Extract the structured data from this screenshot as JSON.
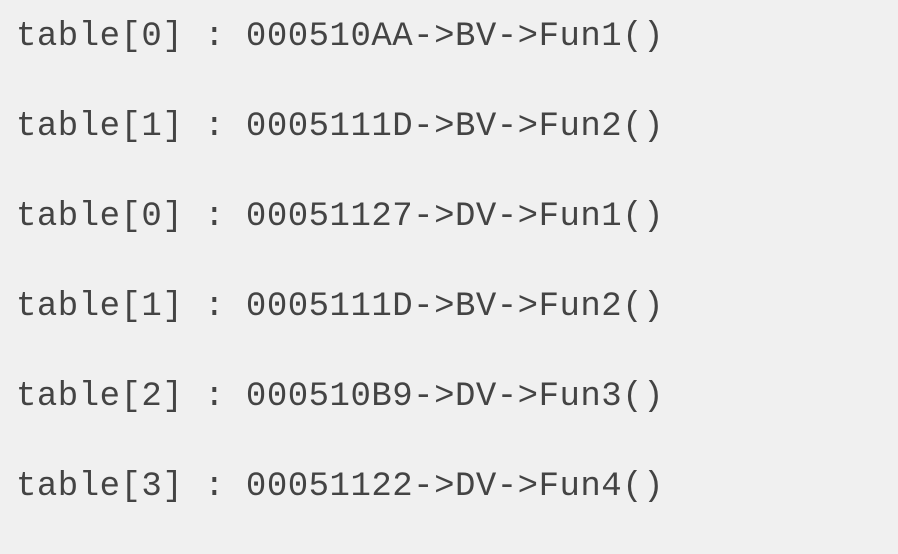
{
  "lines": [
    "table[0] : 000510AA->BV->Fun1()",
    "table[1] : 0005111D->BV->Fun2()",
    "table[0] : 00051127->DV->Fun1()",
    "table[1] : 0005111D->BV->Fun2()",
    "table[2] : 000510B9->DV->Fun3()",
    "table[3] : 00051122->DV->Fun4()"
  ]
}
